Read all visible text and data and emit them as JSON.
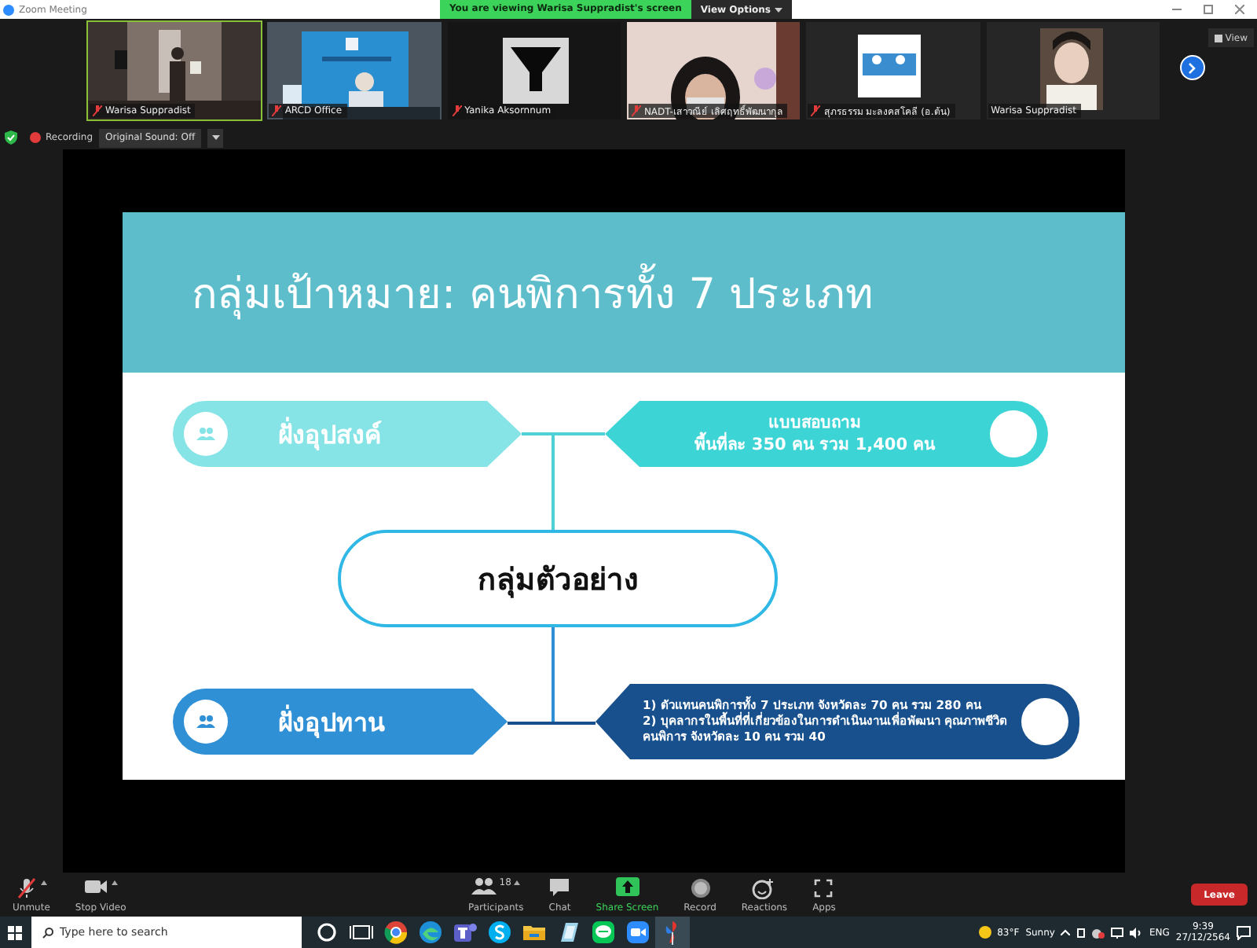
{
  "window": {
    "title": "Zoom Meeting",
    "banner": "You are viewing Warisa Suppradist's screen",
    "view_options": "View Options"
  },
  "gallery": {
    "tiles": [
      {
        "name": "Warisa Suppradist",
        "muted": true,
        "speaking": true,
        "kind": "picture"
      },
      {
        "name": "ARCD Office",
        "muted": true,
        "speaking": false,
        "kind": "picture"
      },
      {
        "name": "Yanika Aksornnum",
        "muted": true,
        "speaking": false,
        "kind": "picture"
      },
      {
        "name": "NADT-เสาวณีย์ เลิศฤทธิ์พัฒนากุล",
        "muted": true,
        "speaking": false,
        "kind": "picture"
      },
      {
        "name": "สุภรธรรม มะลงคสโคลี (อ.ต้น)",
        "muted": true,
        "speaking": false,
        "kind": "picture"
      },
      {
        "name": "Warisa Suppradist",
        "muted": false,
        "speaking": false,
        "kind": "picture"
      }
    ],
    "view_button": "View"
  },
  "meeting_bar": {
    "recording": "Recording",
    "sound": "Original Sound: Off"
  },
  "slide": {
    "title": "กลุ่มเป้าหมาย: คนพิการทั้ง 7 ประเภท",
    "center": "กลุ่มตัวอย่าง",
    "rows": [
      {
        "label": "ฝั่งอุปสงค์",
        "color": "#86e3e6",
        "kind": "survey",
        "details": [
          "แบบสอบถาม",
          "พื้นที่ละ 350 คน รวม 1,400 คน"
        ]
      },
      {
        "label": "ฝั่งอุปทาน",
        "color": "#2f90d6",
        "kind": "list",
        "details": [
          "1) ตัวแทนคนพิการทั้ง 7 ประเภท จังหวัดละ 70 คน รวม 280 คน",
          "2) บุคลากรในพื้นที่ที่เกี่ยวข้องในการดำเนินงานเพื่อพัฒนา คุณภาพชีวิตคนพิการ จังหวัดละ 10 คน รวม 40"
        ]
      }
    ]
  },
  "toolbar": {
    "left": [
      {
        "label": "Unmute",
        "kind": "mic",
        "has_menu": true
      },
      {
        "label": "Stop Video",
        "kind": "video",
        "has_menu": true
      }
    ],
    "center": [
      {
        "label": "Participants",
        "kind": "participants",
        "count": "18",
        "has_menu": true
      },
      {
        "label": "Chat",
        "kind": "chat",
        "has_menu": false
      },
      {
        "label": "Share Screen",
        "kind": "share",
        "has_menu": false
      },
      {
        "label": "Record",
        "kind": "record",
        "has_menu": false
      },
      {
        "label": "Reactions",
        "kind": "reactions",
        "has_menu": false
      },
      {
        "label": "Apps",
        "kind": "apps",
        "has_menu": false
      }
    ],
    "leave": "Leave"
  },
  "taskbar": {
    "search_placeholder": "Type here to search",
    "apps": [
      {
        "kind": "cortana",
        "selected": false
      },
      {
        "kind": "taskview",
        "selected": false
      },
      {
        "kind": "browser",
        "selected": false
      },
      {
        "kind": "edge",
        "selected": false
      },
      {
        "kind": "teams",
        "selected": false
      },
      {
        "kind": "skype",
        "selected": false
      },
      {
        "kind": "folder",
        "selected": false
      },
      {
        "kind": "notes",
        "selected": false
      },
      {
        "kind": "line",
        "selected": false
      },
      {
        "kind": "zoom",
        "selected": false
      },
      {
        "kind": "pin",
        "selected": true
      }
    ],
    "weather_temp": "83°F",
    "weather_text": "Sunny",
    "language": "ENG",
    "time": "9:39",
    "date": "27/12/2564"
  }
}
